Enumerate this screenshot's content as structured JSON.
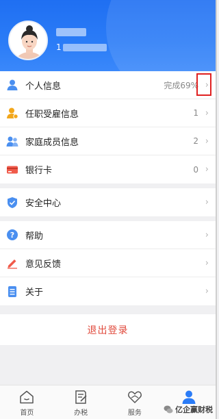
{
  "profile": {
    "id_visible_prefix": "1"
  },
  "groups": {
    "info": [
      {
        "key": "personal",
        "label": "个人信息",
        "value": "完成69%",
        "icon": "person-icon"
      },
      {
        "key": "employment",
        "label": "任职受雇信息",
        "value": "1",
        "icon": "employee-badge-icon"
      },
      {
        "key": "family",
        "label": "家庭成员信息",
        "value": "2",
        "icon": "family-icon"
      },
      {
        "key": "bankcard",
        "label": "银行卡",
        "value": "0",
        "icon": "bank-card-icon"
      }
    ],
    "security": [
      {
        "key": "security",
        "label": "安全中心",
        "icon": "shield-icon"
      }
    ],
    "misc": [
      {
        "key": "help",
        "label": "帮助",
        "icon": "help-icon"
      },
      {
        "key": "feedback",
        "label": "意见反馈",
        "icon": "pencil-icon"
      },
      {
        "key": "about",
        "label": "关于",
        "icon": "document-icon"
      }
    ]
  },
  "logout_label": "退出登录",
  "tabs": [
    {
      "label": "首页",
      "icon": "home-icon",
      "active": false
    },
    {
      "label": "办税",
      "icon": "tax-form-icon",
      "active": false
    },
    {
      "label": "服务",
      "icon": "service-heart-icon",
      "active": false
    },
    {
      "label": "",
      "icon": "profile-icon",
      "active": true
    }
  ],
  "watermark": "亿企赢财税",
  "colors": {
    "brand_blue": "#2b7cf7",
    "logout_red": "#e04a3c",
    "highlight_red": "#e02020"
  },
  "chevron": "›"
}
